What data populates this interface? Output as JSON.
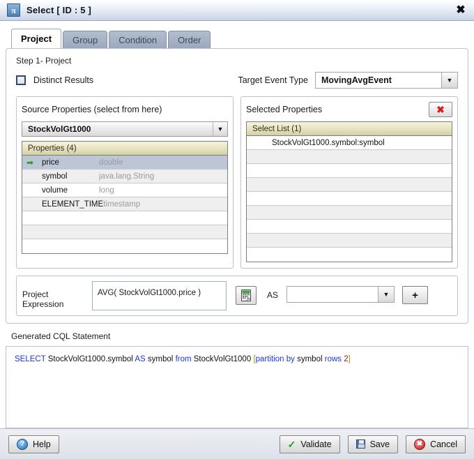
{
  "window": {
    "title": "Select [ ID : 5 ]",
    "icon": "pi-icon",
    "icon_glyph": "π",
    "close_label": "✖"
  },
  "tabs": [
    {
      "label": "Project",
      "active": true
    },
    {
      "label": "Group",
      "active": false
    },
    {
      "label": "Condition",
      "active": false
    },
    {
      "label": "Order",
      "active": false
    }
  ],
  "panel": {
    "step_label": "Step 1- Project",
    "distinct_results_label": "Distinct Results",
    "distinct_results_checked": false,
    "target_event_type_label": "Target Event Type",
    "target_event_type_value": "MovingAvgEvent"
  },
  "source_properties": {
    "title": "Source Properties (select from here)",
    "stream_value": "StockVolGt1000",
    "table_header": "Properties (4)",
    "rows": [
      {
        "name": "price",
        "type": "double",
        "selected": true
      },
      {
        "name": "symbol",
        "type": "java.lang.String",
        "selected": false
      },
      {
        "name": "volume",
        "type": "long",
        "selected": false
      },
      {
        "name": "ELEMENT_TIME",
        "type": "timestamp",
        "selected": false
      }
    ],
    "empty_rows": 3
  },
  "selected_properties": {
    "title": "Selected Properties",
    "delete_label": "✖",
    "table_header": "Select List (1)",
    "items": [
      "StockVolGt1000.symbol:symbol"
    ],
    "empty_rows": 8
  },
  "project_expression": {
    "label": "Project Expression",
    "value": "AVG( StockVolGt1000.price )",
    "function_button_name": "function-calculator-icon",
    "as_label": "AS",
    "as_value": "",
    "add_label": "+"
  },
  "cql": {
    "label": "Generated CQL Statement",
    "tokens": [
      {
        "text": "SELECT",
        "kind": "kw"
      },
      {
        "text": " StockVolGt1000.symbol ",
        "kind": "pln"
      },
      {
        "text": "AS",
        "kind": "kw"
      },
      {
        "text": " symbol ",
        "kind": "pln"
      },
      {
        "text": "from",
        "kind": "kw"
      },
      {
        "text": "  StockVolGt1000  ",
        "kind": "pln"
      },
      {
        "text": "[",
        "kind": "brk"
      },
      {
        "text": "partition by",
        "kind": "kw"
      },
      {
        "text": "  symbol  ",
        "kind": "pln"
      },
      {
        "text": "rows",
        "kind": "kw"
      },
      {
        "text": " ",
        "kind": "pln"
      },
      {
        "text": "2",
        "kind": "num"
      },
      {
        "text": "]",
        "kind": "brk"
      }
    ],
    "plain_text": "SELECT StockVolGt1000.symbol AS symbol from  StockVolGt1000  [partition by  symbol  rows 2]"
  },
  "footer": {
    "help_label": "Help",
    "validate_label": "Validate",
    "save_label": "Save",
    "cancel_label": "Cancel"
  },
  "colors": {
    "accent": "#4f7fb5",
    "keyword": "#1a37d8",
    "bracket": "#b38b1d",
    "number": "#8f1717",
    "selected_row": "#bcc6d6",
    "table_header": "#e6e2c0",
    "delete_red": "#d32020",
    "arrow_green": "#2f9a18"
  }
}
